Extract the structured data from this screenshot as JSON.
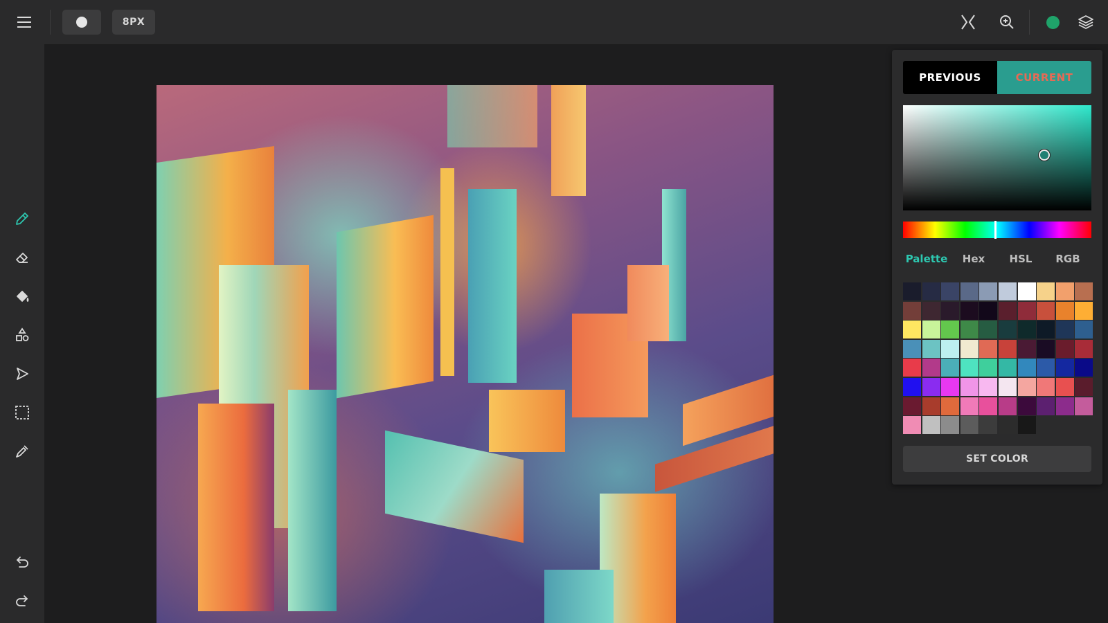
{
  "toolbar": {
    "brush_size": "8PX",
    "brush_shape_icon": "circle-brush-icon",
    "current_color": "#1fa36a"
  },
  "tools": [
    {
      "name": "pencil-icon",
      "active": true
    },
    {
      "name": "eraser-icon",
      "active": false
    },
    {
      "name": "fill-bucket-icon",
      "active": false
    },
    {
      "name": "shapes-icon",
      "active": false
    },
    {
      "name": "line-tool-icon",
      "active": false
    },
    {
      "name": "selection-icon",
      "active": false
    },
    {
      "name": "eyedropper-icon",
      "active": false
    },
    {
      "name": "undo-icon",
      "active": false
    },
    {
      "name": "redo-icon",
      "active": false
    }
  ],
  "panel": {
    "previous_label": "PREVIOUS",
    "current_label": "CURRENT",
    "previous_color": "#000000",
    "current_color": "#2a9d8f",
    "tabs": [
      "Palette",
      "Hex",
      "HSL",
      "RGB"
    ],
    "active_tab": "Palette",
    "set_button": "SET COLOR",
    "swatches": [
      "#1a1c2c",
      "#262b44",
      "#3a4466",
      "#5a6988",
      "#8b9bb4",
      "#c0cbdc",
      "#ffffff",
      "#f6d28a",
      "#f2a06c",
      "#b86f50",
      "#733e39",
      "#3e2731",
      "#2a1a2b",
      "#1c0c1f",
      "#12081a",
      "#5a1f2d",
      "#8f2c3a",
      "#c8503c",
      "#e9822c",
      "#feae34",
      "#fee761",
      "#c8f49a",
      "#63c74d",
      "#3e8948",
      "#265c42",
      "#193c3e",
      "#0f2a2b",
      "#0e1a27",
      "#1f3658",
      "#2e5f8f",
      "#4a90b8",
      "#6cc3c3",
      "#bdeff0",
      "#f0ead0",
      "#e06a55",
      "#c8423a",
      "#4a1a34",
      "#1a0c24",
      "#6a1c2c",
      "#a82c38",
      "#e83b4a",
      "#b23a8a",
      "#4bafb8",
      "#4ee3c0",
      "#3fcf9c",
      "#34b8a5",
      "#3288bd",
      "#2c5aa8",
      "#1428a0",
      "#0a0a88",
      "#2010f0",
      "#8a2cf0",
      "#e838f0",
      "#f095e8",
      "#f8b8f0",
      "#f4e6f0",
      "#f4a6a0",
      "#f07878",
      "#e85050",
      "#5a1c2c",
      "#6a1a30",
      "#a83c2c",
      "#e06a3c",
      "#f07ab8",
      "#e8509c",
      "#b83c88",
      "#3c0a3c",
      "#5c2070",
      "#8c2c8c",
      "#c45c9c",
      "#f08cb4",
      "#c0c0c0",
      "#8c8c8c",
      "#5c5c5c",
      "#3c3c3c",
      "#2c2c2c",
      "#181818"
    ]
  }
}
